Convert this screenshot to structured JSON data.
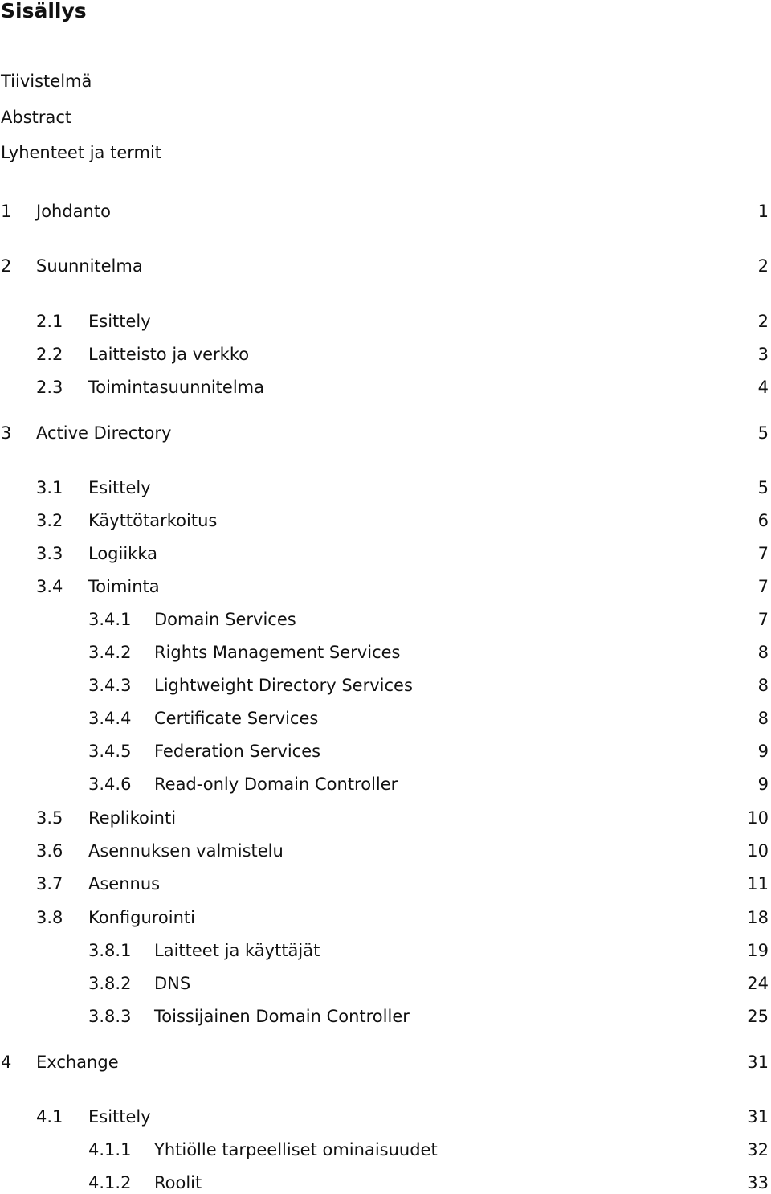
{
  "title": "Sisällys",
  "front_matter": [
    "Tiivistelmä",
    "Abstract",
    "Lyhenteet ja termit"
  ],
  "toc": [
    {
      "level": 1,
      "number": "1",
      "label": "Johdanto",
      "page": "1"
    },
    {
      "level": 1,
      "number": "2",
      "label": "Suunnitelma",
      "page": "2"
    },
    {
      "level": 2,
      "number": "2.1",
      "label": "Esittely",
      "page": "2"
    },
    {
      "level": 2,
      "number": "2.2",
      "label": "Laitteisto ja verkko",
      "page": "3"
    },
    {
      "level": 2,
      "number": "2.3",
      "label": "Toimintasuunnitelma",
      "page": "4"
    },
    {
      "level": 1,
      "number": "3",
      "label": "Active Directory",
      "page": "5"
    },
    {
      "level": 2,
      "number": "3.1",
      "label": "Esittely",
      "page": "5"
    },
    {
      "level": 2,
      "number": "3.2",
      "label": "Käyttötarkoitus",
      "page": "6"
    },
    {
      "level": 2,
      "number": "3.3",
      "label": "Logiikka",
      "page": "7"
    },
    {
      "level": 2,
      "number": "3.4",
      "label": "Toiminta",
      "page": "7"
    },
    {
      "level": 3,
      "number": "3.4.1",
      "label": "Domain Services",
      "page": "7"
    },
    {
      "level": 3,
      "number": "3.4.2",
      "label": "Rights Management Services",
      "page": "8"
    },
    {
      "level": 3,
      "number": "3.4.3",
      "label": "Lightweight Directory Services",
      "page": "8"
    },
    {
      "level": 3,
      "number": "3.4.4",
      "label": "Certificate Services",
      "page": "8"
    },
    {
      "level": 3,
      "number": "3.4.5",
      "label": "Federation Services",
      "page": "9"
    },
    {
      "level": 3,
      "number": "3.4.6",
      "label": "Read-only Domain Controller",
      "page": "9"
    },
    {
      "level": 2,
      "number": "3.5",
      "label": "Replikointi",
      "page": "10"
    },
    {
      "level": 2,
      "number": "3.6",
      "label": "Asennuksen valmistelu",
      "page": "10"
    },
    {
      "level": 2,
      "number": "3.7",
      "label": "Asennus",
      "page": "11"
    },
    {
      "level": 2,
      "number": "3.8",
      "label": "Konfigurointi",
      "page": "18"
    },
    {
      "level": 3,
      "number": "3.8.1",
      "label": "Laitteet ja käyttäjät",
      "page": "19"
    },
    {
      "level": 3,
      "number": "3.8.2",
      "label": "DNS",
      "page": "24"
    },
    {
      "level": 3,
      "number": "3.8.3",
      "label": "Toissijainen Domain Controller",
      "page": "25"
    },
    {
      "level": 1,
      "number": "4",
      "label": "Exchange",
      "page": "31"
    },
    {
      "level": 2,
      "number": "4.1",
      "label": "Esittely",
      "page": "31"
    },
    {
      "level": 3,
      "number": "4.1.1",
      "label": "Yhtiölle tarpeelliset ominaisuudet",
      "page": "32"
    },
    {
      "level": 3,
      "number": "4.1.2",
      "label": "Roolit",
      "page": "33"
    }
  ]
}
